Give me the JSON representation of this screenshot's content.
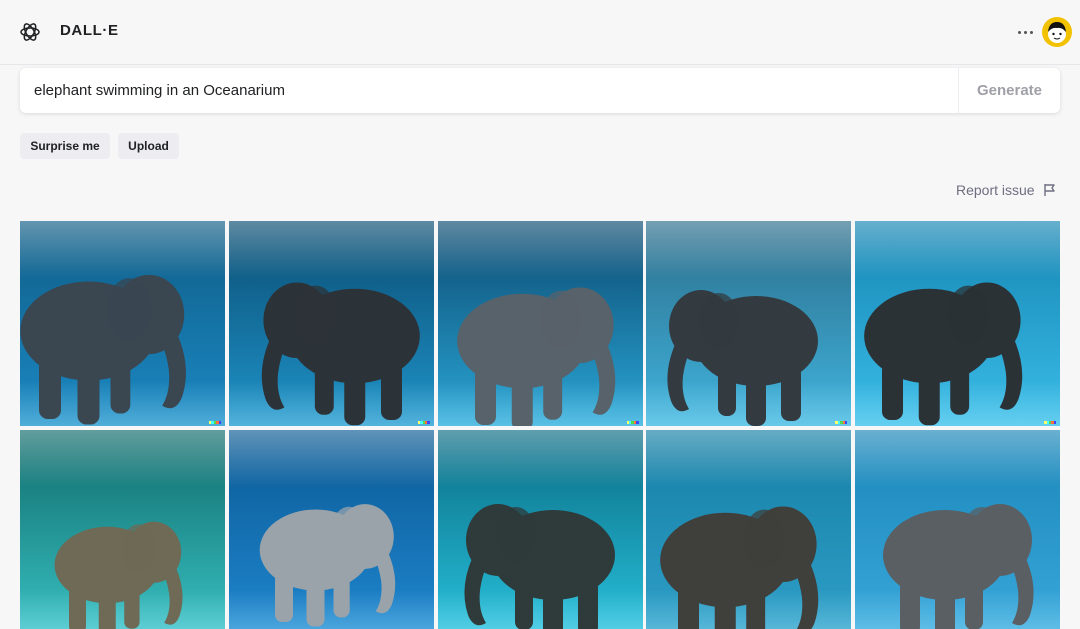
{
  "app": {
    "title": "DALL·E"
  },
  "prompt": {
    "value": "elephant swimming in an Oceanarium",
    "generate_label": "Generate"
  },
  "actions": {
    "surprise_label": "Surprise me",
    "upload_label": "Upload"
  },
  "report": {
    "label": "Report issue"
  },
  "colors": {
    "background": "#f7f7f8",
    "avatar": "#f2c200",
    "chip": "#ececf1",
    "muted_text": "#6e6e80",
    "watermark": [
      "#ffff66",
      "#42ffff",
      "#51da4c",
      "#ff6e3c",
      "#3c46ff"
    ]
  },
  "icons": {
    "logo": "openai-logo-icon",
    "more": "more-horizontal-icon",
    "report": "flag-icon"
  },
  "images": [
    {
      "alt": "generated image 1",
      "top": "#0f5d86",
      "bottom": "#1b89c4",
      "elephant": "#3a4650"
    },
    {
      "alt": "generated image 2",
      "top": "#0a4d72",
      "bottom": "#1f93c9",
      "elephant": "#2c3338"
    },
    {
      "alt": "generated image 3",
      "top": "#0b4a70",
      "bottom": "#2aa6d6",
      "elephant": "#58626a"
    },
    {
      "alt": "generated image 4",
      "top": "#2b6d8a",
      "bottom": "#41b4de",
      "elephant": "#333b40"
    },
    {
      "alt": "generated image 5",
      "top": "#1585b3",
      "bottom": "#3bbde8",
      "elephant": "#2b3236"
    },
    {
      "alt": "generated image 6",
      "top": "#0f6a6a",
      "bottom": "#39c1c3",
      "elephant": "#6e6a55"
    },
    {
      "alt": "generated image 7",
      "top": "#0b5a94",
      "bottom": "#1f86cf",
      "elephant": "#9aa3aa"
    },
    {
      "alt": "generated image 8",
      "top": "#0a6b83",
      "bottom": "#28c1dc",
      "elephant": "#2f3a3a"
    },
    {
      "alt": "generated image 9",
      "top": "#157fa5",
      "bottom": "#2f9fc8",
      "elephant": "#3f3f3b"
    },
    {
      "alt": "generated image 10",
      "top": "#1a86b8",
      "bottom": "#3aa8dc",
      "elephant": "#5a5f63"
    }
  ]
}
